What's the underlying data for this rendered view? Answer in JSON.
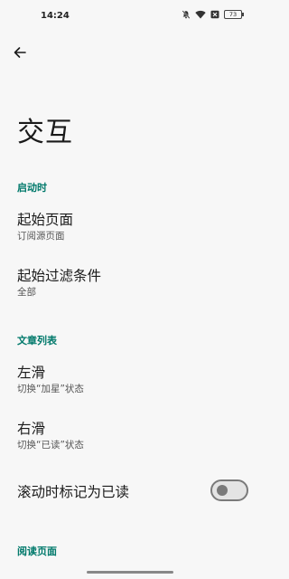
{
  "status_bar": {
    "time": "14:24",
    "battery": "73",
    "icons": [
      "mute-icon",
      "wifi-icon",
      "sim-off-icon",
      "battery-icon"
    ]
  },
  "app_bar": {
    "back_icon": "arrow-left-icon"
  },
  "page": {
    "title": "交互"
  },
  "sections": [
    {
      "header": "启动时",
      "items": [
        {
          "title": "起始页面",
          "summary": "订阅源页面"
        },
        {
          "title": "起始过滤条件",
          "summary": "全部"
        }
      ]
    },
    {
      "header": "文章列表",
      "items": [
        {
          "title": "左滑",
          "summary": "切换“加星”状态"
        },
        {
          "title": "右滑",
          "summary": "切换“已读”状态"
        },
        {
          "title": "滚动时标记为已读",
          "switch_on": false
        }
      ]
    },
    {
      "header": "阅读页面"
    }
  ],
  "colors": {
    "accent": "#00796b",
    "background": "#f7f7f7"
  }
}
